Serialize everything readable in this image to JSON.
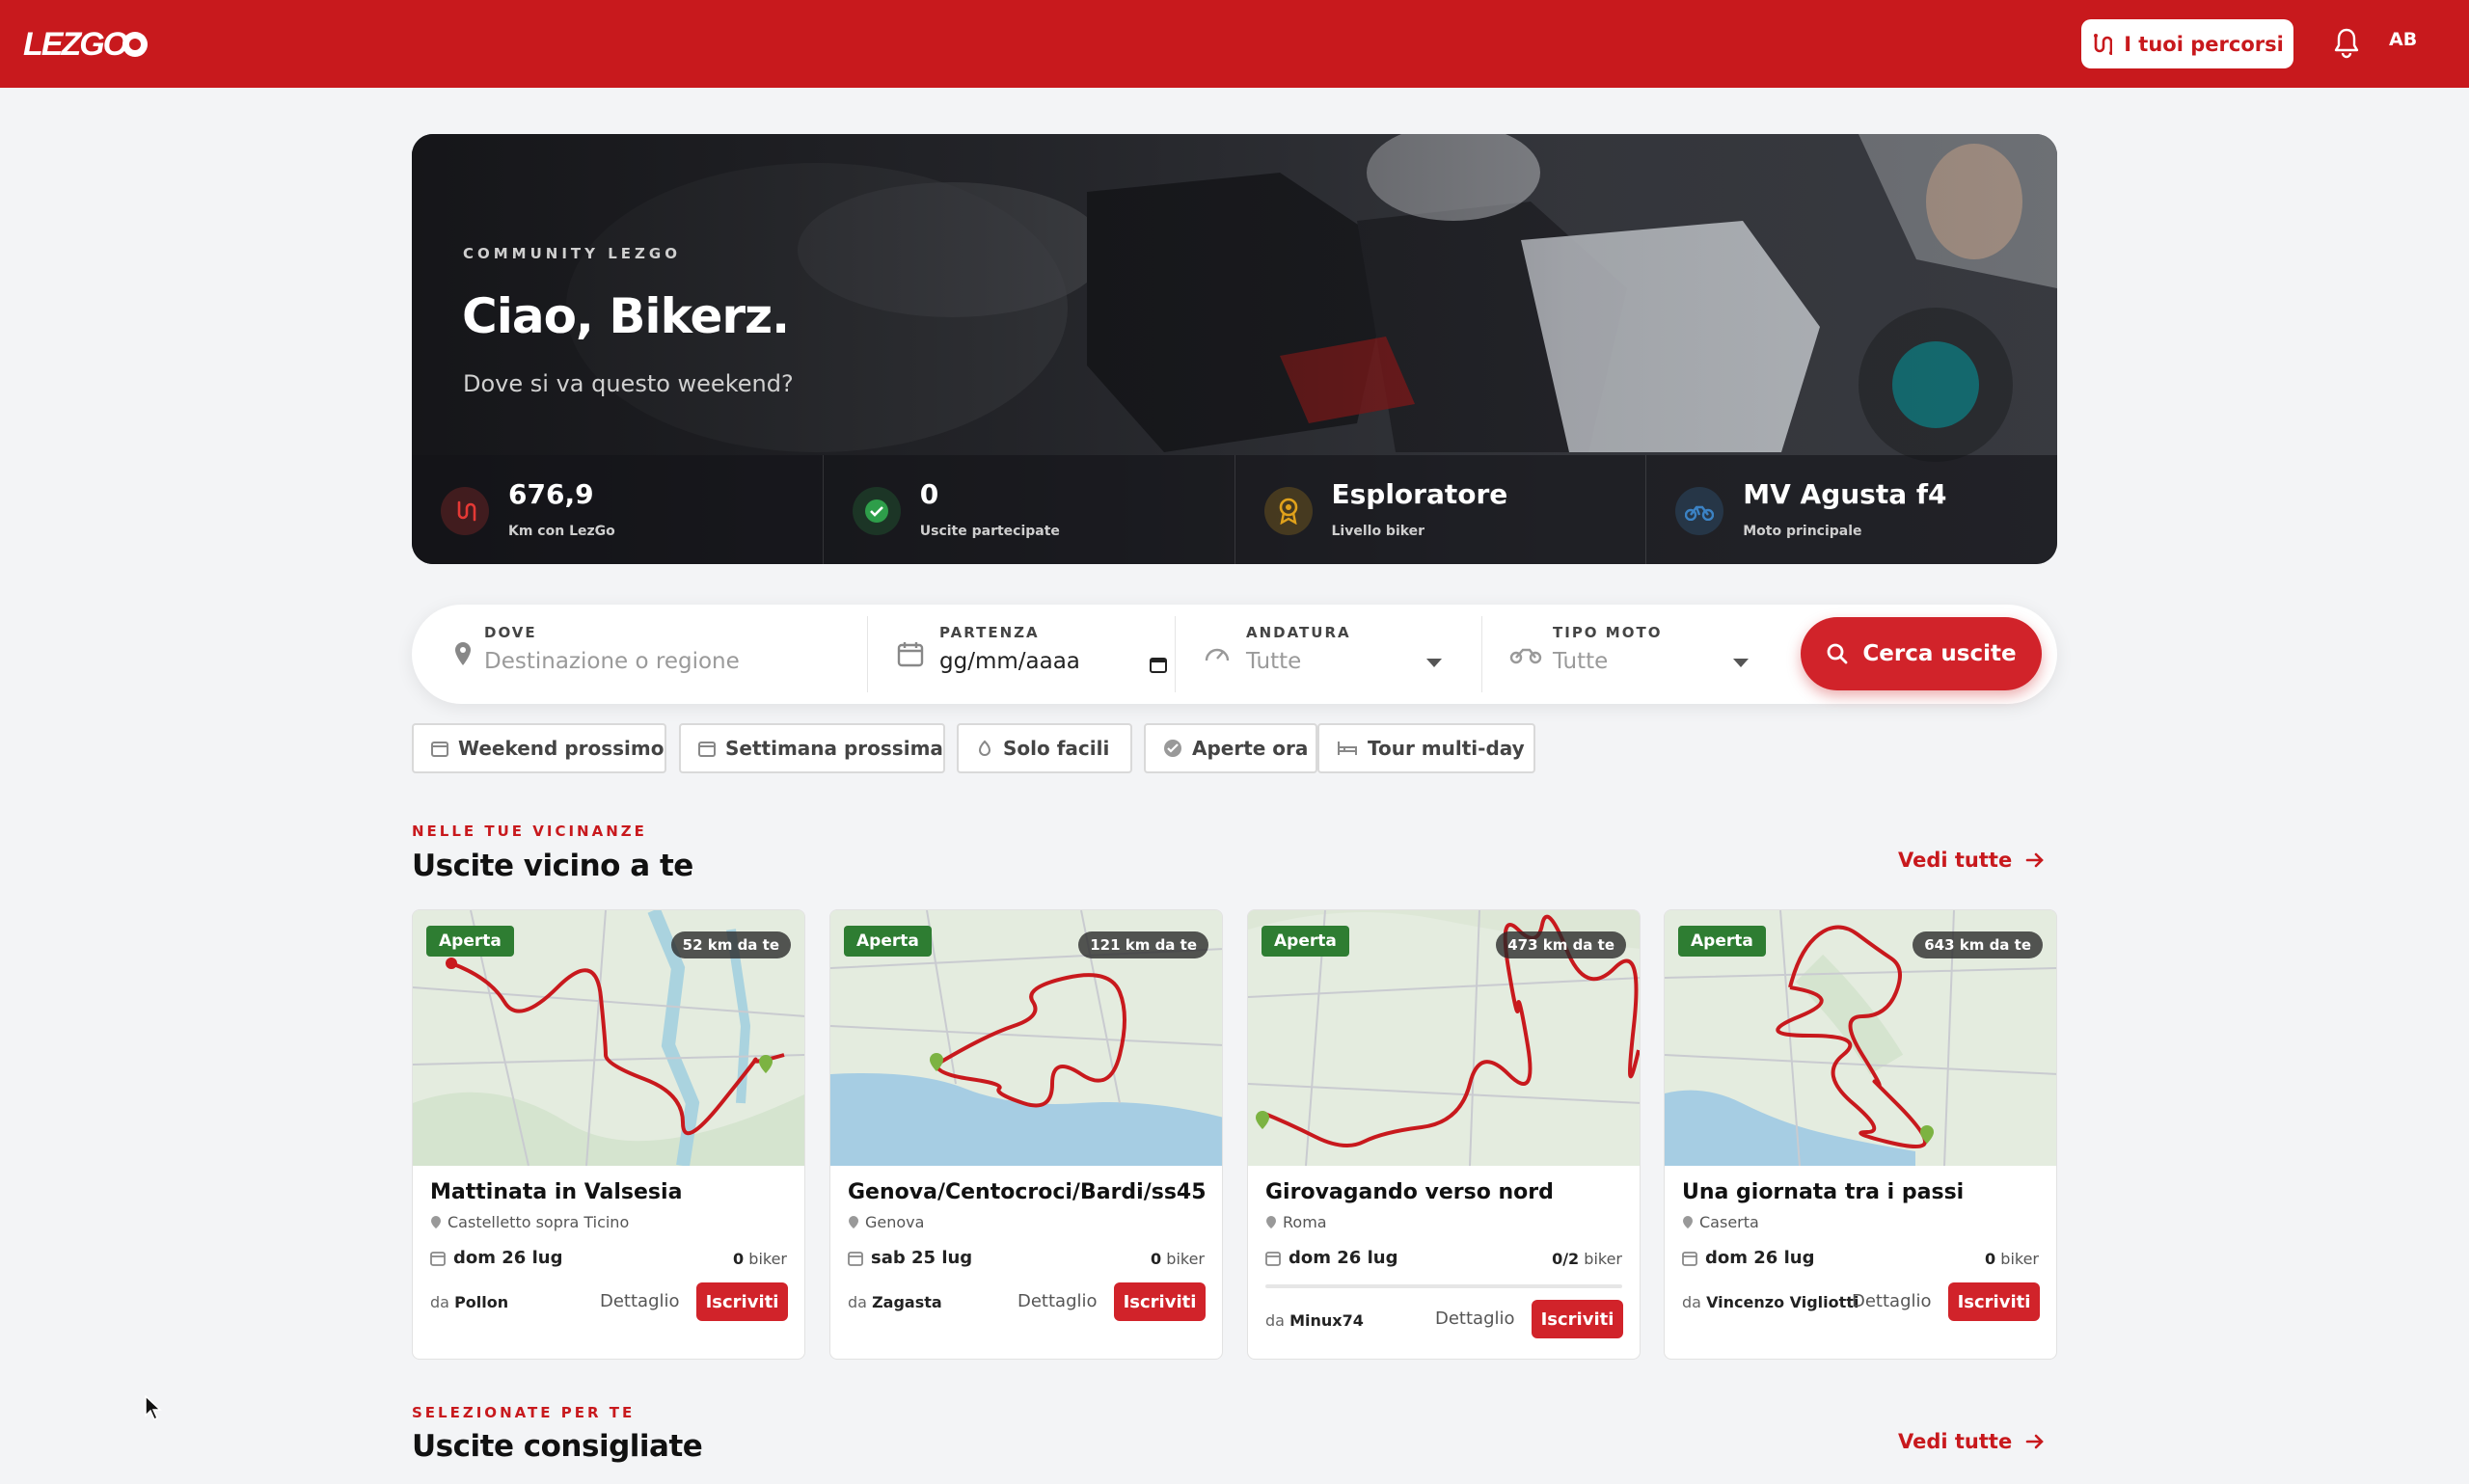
{
  "header": {
    "logo": "LEZGO",
    "routes_button": "I tuoi percorsi",
    "avatar": "AB"
  },
  "hero": {
    "kicker": "COMMUNITY LEZGO",
    "title": "Ciao, Bikerz.",
    "subtitle": "Dove si va questo weekend?",
    "stats": [
      {
        "value": "676,9",
        "label": "Km con LezGo",
        "icon": "route-icon",
        "color": "#e53935"
      },
      {
        "value": "0",
        "label": "Uscite partecipate",
        "icon": "check-circle-icon",
        "color": "#2e9e4a"
      },
      {
        "value": "Esploratore",
        "label": "Livello biker",
        "icon": "award-icon",
        "color": "#e0a21b"
      },
      {
        "value": "MV Agusta f4",
        "label": "Moto principale",
        "icon": "motorcycle-icon",
        "color": "#3b82c4"
      }
    ]
  },
  "search": {
    "where": {
      "label": "DOVE",
      "placeholder": "Destinazione o regione"
    },
    "departure": {
      "label": "PARTENZA",
      "value": "gg/mm/aaaa"
    },
    "pace": {
      "label": "ANDATURA",
      "value": "Tutte"
    },
    "bike_type": {
      "label": "TIPO MOTO",
      "value": "Tutte"
    },
    "button": "Cerca uscite"
  },
  "chips": [
    {
      "label": "Weekend prossimo",
      "icon": "calendar-icon"
    },
    {
      "label": "Settimana prossima",
      "icon": "calendar-icon"
    },
    {
      "label": "Solo facili",
      "icon": "leaf-icon"
    },
    {
      "label": "Aperte ora",
      "icon": "check-circle-icon"
    },
    {
      "label": "Tour multi-day",
      "icon": "bed-icon"
    }
  ],
  "nearby": {
    "kicker": "NELLE TUE VICINANZE",
    "title": "Uscite vicino a te",
    "see_all": "Vedi tutte",
    "cards": [
      {
        "status": "Aperta",
        "distance": "52 km da te",
        "title": "Mattinata in Valsesia",
        "location": "Castelletto sopra Ticino",
        "date": "dom 26 lug",
        "bikers": "0",
        "bikers_suffix": "biker",
        "by_prefix": "da",
        "organizer": "Pollon",
        "detail": "Dettaglio",
        "join": "Iscriviti"
      },
      {
        "status": "Aperta",
        "distance": "121 km da te",
        "title": "Genova/Centocroci/Bardi/ss45",
        "location": "Genova",
        "date": "sab 25 lug",
        "bikers": "0",
        "bikers_suffix": "biker",
        "by_prefix": "da",
        "organizer": "Zagasta",
        "detail": "Dettaglio",
        "join": "Iscriviti"
      },
      {
        "status": "Aperta",
        "distance": "473 km da te",
        "title": "Girovagando verso nord",
        "location": "Roma",
        "date": "dom 26 lug",
        "bikers": "0/2",
        "bikers_suffix": "biker",
        "by_prefix": "da",
        "organizer": "Minux74",
        "detail": "Dettaglio",
        "join": "Iscriviti",
        "fill": 0
      },
      {
        "status": "Aperta",
        "distance": "643 km da te",
        "title": "Una giornata tra i passi",
        "location": "Caserta",
        "date": "dom 26 lug",
        "bikers": "0",
        "bikers_suffix": "biker",
        "by_prefix": "da",
        "organizer": "Vincenzo Vigliotti",
        "detail": "Dettaglio",
        "join": "Iscriviti"
      }
    ]
  },
  "recommended": {
    "kicker": "SELEZIONATE PER TE",
    "title": "Uscite consigliate",
    "see_all": "Vedi tutte"
  },
  "colors": {
    "brand": "#c8191d",
    "open": "#2e7d32"
  }
}
